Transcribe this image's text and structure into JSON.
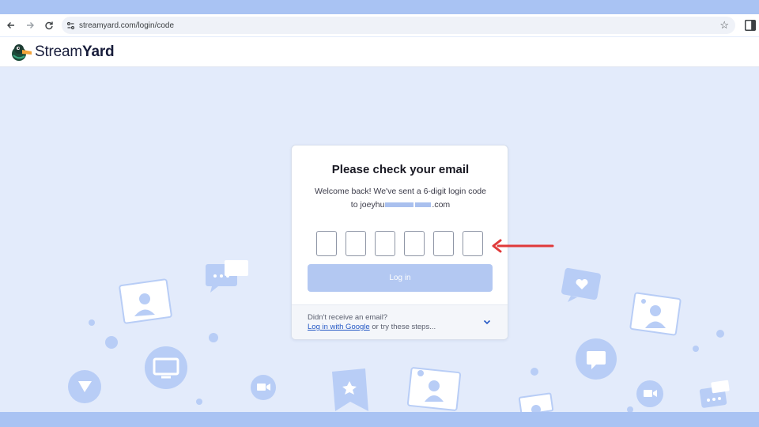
{
  "browser": {
    "url": "streamyard.com/login/code",
    "icons": [
      "back-icon",
      "forward-icon",
      "reload-icon",
      "site-settings-icon",
      "star-icon",
      "side-panel-icon"
    ]
  },
  "header": {
    "logo_light": "Stream",
    "logo_bold": "Yard"
  },
  "card": {
    "title": "Please check your email",
    "message_line1": "Welcome back! We've sent a 6-digit login code",
    "message_to": "to joeyhu",
    "message_domain": ".com",
    "code_count": 6,
    "login_button": "Log in",
    "footer": {
      "question": "Didn't receive an email?",
      "google_link": "Log in with Google",
      "rest": " or try these steps..."
    }
  },
  "colors": {
    "background": "#e3ebfb",
    "frame": "#a9c3f3",
    "button_disabled": "#b3c8f2",
    "link": "#2458c5",
    "annotation": "#e03a3a"
  }
}
